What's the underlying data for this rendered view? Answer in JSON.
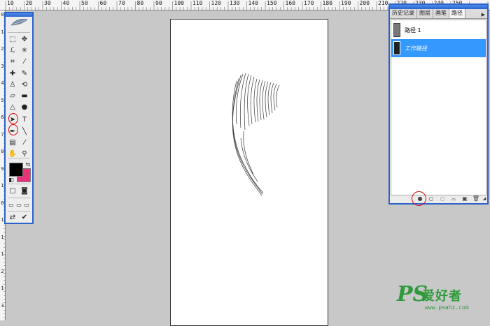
{
  "ruler": {
    "top_labels": [
      "10",
      "20",
      "30",
      "40",
      "50",
      "60",
      "70",
      "80",
      "90",
      "100",
      "110",
      "120",
      "130",
      "140",
      "150",
      "160",
      "170",
      "180",
      "190",
      "200",
      "210",
      "220",
      "230",
      "240",
      "250"
    ],
    "left_labels": [
      "0",
      "1",
      "2",
      "3",
      "4",
      "5",
      "6",
      "7",
      "8",
      "9",
      "1",
      "0",
      "1",
      "1",
      "1",
      "2",
      "1",
      "3"
    ]
  },
  "toolbox": {
    "tools": [
      {
        "name": "marquee-tool-icon",
        "glyph": "⬚"
      },
      {
        "name": "move-tool-icon",
        "glyph": "✥"
      },
      {
        "name": "lasso-tool-icon",
        "glyph": "ℒ"
      },
      {
        "name": "magic-wand-tool-icon",
        "glyph": "✳"
      },
      {
        "name": "crop-tool-icon",
        "glyph": "⌗"
      },
      {
        "name": "slice-tool-icon",
        "glyph": "⁄"
      },
      {
        "name": "healing-brush-tool-icon",
        "glyph": "✚"
      },
      {
        "name": "brush-tool-icon",
        "glyph": "✎"
      },
      {
        "name": "clone-stamp-tool-icon",
        "glyph": "♙"
      },
      {
        "name": "history-brush-tool-icon",
        "glyph": "⟲"
      },
      {
        "name": "eraser-tool-icon",
        "glyph": "▱"
      },
      {
        "name": "gradient-tool-icon",
        "glyph": "▬"
      },
      {
        "name": "blur-tool-icon",
        "glyph": "△"
      },
      {
        "name": "dodge-tool-icon",
        "glyph": "●"
      },
      {
        "name": "path-selection-tool-icon",
        "glyph": "➤"
      },
      {
        "name": "type-tool-icon",
        "glyph": "T"
      },
      {
        "name": "pen-tool-icon",
        "glyph": "✒"
      },
      {
        "name": "line-tool-icon",
        "glyph": "╲"
      },
      {
        "name": "notes-tool-icon",
        "glyph": "▤"
      },
      {
        "name": "eyedropper-tool-icon",
        "glyph": "⁄"
      },
      {
        "name": "hand-tool-icon",
        "glyph": "✋"
      },
      {
        "name": "zoom-tool-icon",
        "glyph": "⚲"
      }
    ]
  },
  "panel": {
    "tabs": [
      "历史记录",
      "图层",
      "画笔",
      "路径"
    ],
    "active_tab": "路径",
    "paths": [
      {
        "label": "路径 1",
        "selected": false
      },
      {
        "label": "工作路径",
        "selected": true
      }
    ],
    "bottom_icons": [
      "fill-path-icon",
      "stroke-path-icon",
      "load-selection-icon",
      "make-work-path-icon",
      "new-path-icon",
      "delete-path-icon"
    ]
  },
  "watermark": {
    "brand": "PS",
    "chinese": "爱好者",
    "url": "www.psahz.com"
  },
  "colors": {
    "foreground": "#000000",
    "background": "#e8337a",
    "selected_row": "#3399ff",
    "title_bar": "#2d62c9",
    "watermark_green": "#2f9a3c"
  }
}
